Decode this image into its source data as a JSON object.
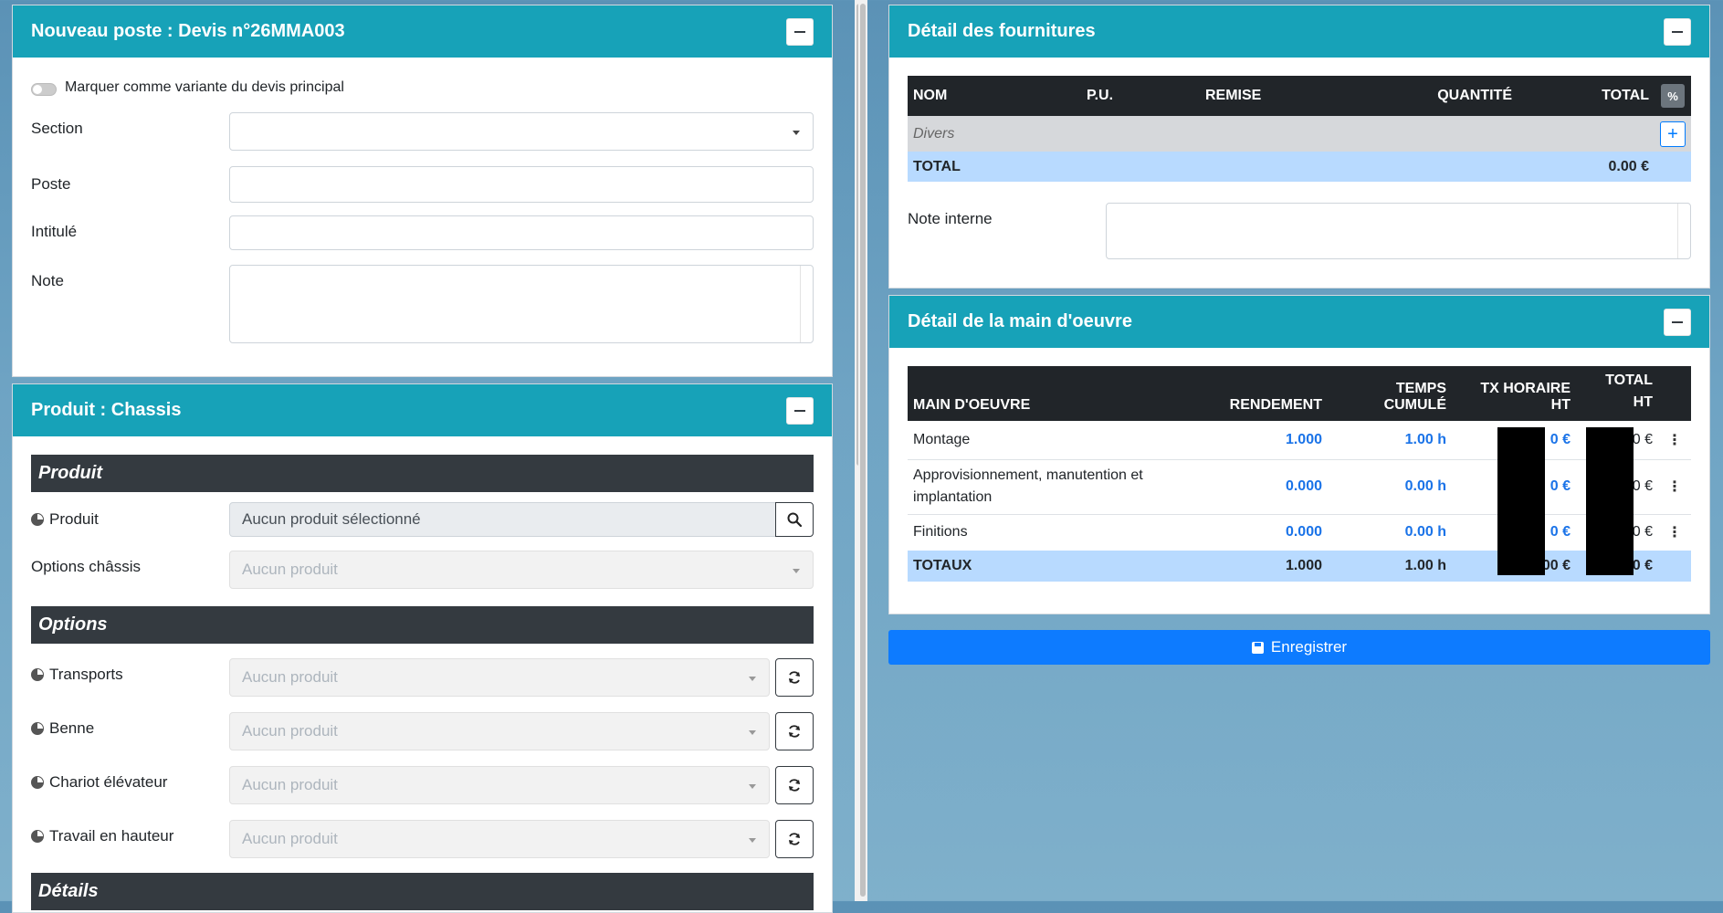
{
  "left": {
    "nouveau_poste": {
      "title": "Nouveau poste : Devis n°26MMA003",
      "variant_label": "Marquer comme variante du devis principal",
      "fields": {
        "section": {
          "label": "Section",
          "value": ""
        },
        "poste": {
          "label": "Poste",
          "value": ""
        },
        "intitule": {
          "label": "Intitulé",
          "value": ""
        },
        "note": {
          "label": "Note",
          "value": ""
        }
      }
    },
    "produit": {
      "title": "Produit : Chassis",
      "section_produit": "Produit",
      "produit_label": "Produit",
      "produit_value": "Aucun produit sélectionné",
      "options_chassis_label": "Options châssis",
      "options_chassis_placeholder": "Aucun produit",
      "section_options": "Options",
      "options": [
        {
          "label": "Transports",
          "placeholder": "Aucun produit"
        },
        {
          "label": "Benne",
          "placeholder": "Aucun produit"
        },
        {
          "label": "Chariot élévateur",
          "placeholder": "Aucun produit"
        },
        {
          "label": "Travail en hauteur",
          "placeholder": "Aucun produit"
        }
      ],
      "section_details": "Détails"
    }
  },
  "right": {
    "fournitures": {
      "title": "Détail des fournitures",
      "headers": {
        "nom": "NOM",
        "pu": "P.U.",
        "remise": "REMISE",
        "quantite": "QUANTITÉ",
        "total": "TOTAL"
      },
      "pct_button": "%",
      "group_label": "Divers",
      "add_button": "+",
      "total_label": "TOTAL",
      "total_value": "0.00 €",
      "note_label": "Note interne",
      "note_value": ""
    },
    "main_oeuvre": {
      "title": "Détail de la main d'oeuvre",
      "headers": {
        "main": "MAIN D'OEUVRE",
        "rendement": "RENDEMENT",
        "temps": "TEMPS CUMULÉ",
        "tx": "TX HORAIRE HT",
        "total_line1": "TOTAL",
        "total_line2": "HT"
      },
      "rows": [
        {
          "name": "Montage",
          "rendement": "1.000",
          "temps": "1.00 h",
          "tx": "0 €",
          "total": "0 €"
        },
        {
          "name": "Approvisionnement, manutention et implantation",
          "rendement": "0.000",
          "temps": "0.00 h",
          "tx": "0 €",
          "total": "0 €"
        },
        {
          "name": "Finitions",
          "rendement": "0.000",
          "temps": "0.00 h",
          "tx": "0 €",
          "total": "0 €"
        }
      ],
      "totaux": {
        "label": "TOTAUX",
        "rendement": "1.000",
        "temps": "1.00 h",
        "tx": "00 €",
        "total": "0 €"
      },
      "row_menu": "⋮"
    },
    "save_button": "Enregistrer"
  },
  "colors": {
    "header": "#17a2b8",
    "dark": "#343a40",
    "primary": "#0d7bff",
    "total_row": "#b8daff"
  },
  "icons": [
    "minus-icon",
    "search-icon",
    "refresh-icon",
    "pie-icon",
    "plus-icon",
    "percent-icon",
    "kebab-icon",
    "floppy-icon",
    "chevron-down-icon"
  ]
}
